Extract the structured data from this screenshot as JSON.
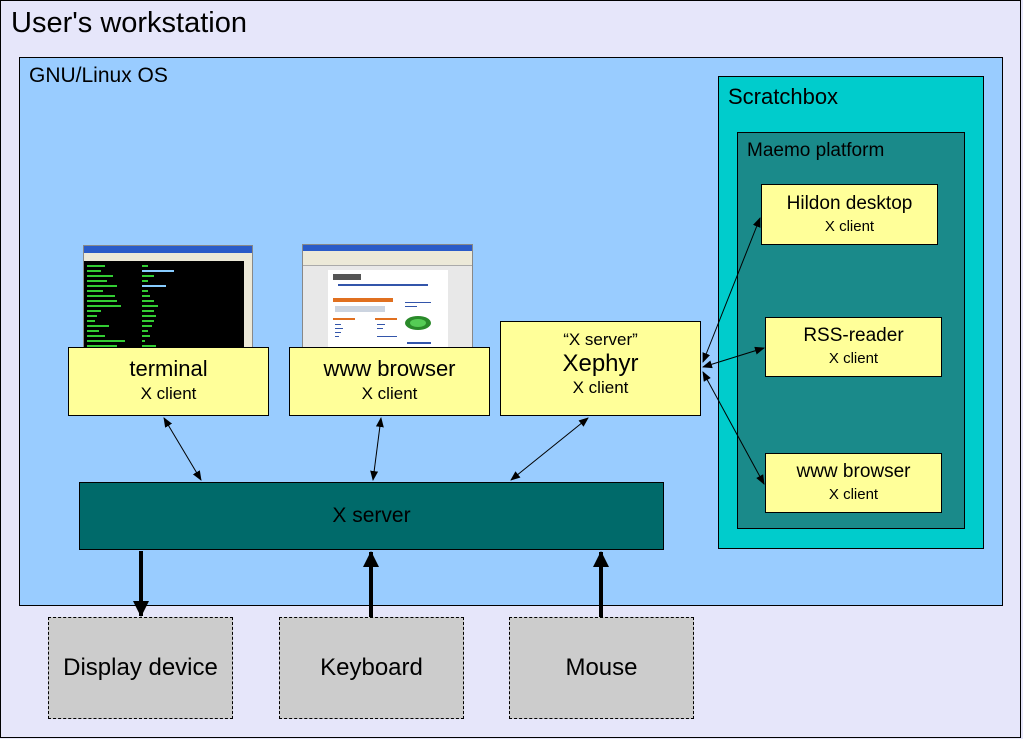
{
  "workstation": {
    "title": "User's workstation"
  },
  "os": {
    "title": "GNU/Linux OS"
  },
  "scratchbox": {
    "title": "Scratchbox"
  },
  "maemo": {
    "title": "Maemo platform",
    "clients": [
      {
        "name": "Hildon desktop",
        "role": "X client"
      },
      {
        "name": "RSS-reader",
        "role": "X client"
      },
      {
        "name": "www browser",
        "role": "X client"
      }
    ]
  },
  "host_clients": [
    {
      "name": "terminal",
      "role": "X client",
      "thumbnail": "terminal-window-screenshot"
    },
    {
      "name": "www browser",
      "role": "X client",
      "thumbnail": "browser-window-screenshot"
    }
  ],
  "xephyr": {
    "caption": "“X server”",
    "name": "Xephyr",
    "role": "X client"
  },
  "xserver": {
    "label": "X server"
  },
  "devices": [
    {
      "name": "Display device",
      "direction": "output"
    },
    {
      "name": "Keyboard",
      "direction": "input"
    },
    {
      "name": "Mouse",
      "direction": "input"
    }
  ],
  "colors": {
    "workstation_bg": "#e6e6fa",
    "os_bg": "#99ccff",
    "scratchbox_bg": "#00cccc",
    "maemo_bg": "#1a8a8a",
    "client_bg": "#ffff99",
    "xserver_bg": "#006a6a",
    "device_bg": "#cccccc"
  }
}
